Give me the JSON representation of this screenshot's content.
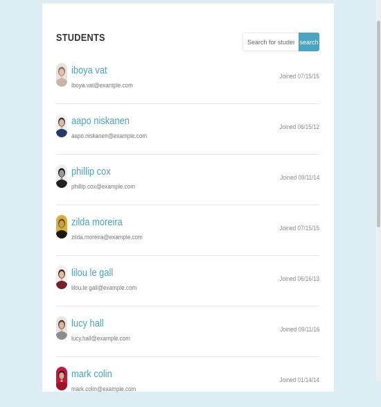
{
  "header": {
    "title": "STUDENTS"
  },
  "search": {
    "placeholder": "Search for students...",
    "button_label": "search"
  },
  "colors": {
    "accent": "#4aa3c0",
    "page_background": "#dcedf3"
  },
  "students": [
    {
      "name": "iboya vat",
      "email": "iboya.vat@example.com",
      "joined": "Joined 07/15/15",
      "avatar": {
        "hair": "#8a6a58",
        "skin": "#e3c2ad",
        "shirt": "#c9b3a8",
        "bg": "#e8e2dd"
      }
    },
    {
      "name": "aapo niskanen",
      "email": "aapo.niskanen@example.com",
      "joined": "Joined 06/15/12",
      "avatar": {
        "hair": "#3a3a3a",
        "skin": "#dcbba3",
        "shirt": "#233a6b",
        "bg": "#f1f1f1"
      }
    },
    {
      "name": "phillip cox",
      "email": "phillip.cox@example.com",
      "joined": "Joined 09/11/14",
      "avatar": {
        "hair": "#111111",
        "skin": "#9a9a9a",
        "shirt": "#222222",
        "bg": "#ededed"
      }
    },
    {
      "name": "zilda moreira",
      "email": "zilda.moreira@example.com",
      "joined": "Joined 07/15/15",
      "avatar": {
        "hair": "#6b4a12",
        "skin": "#c7a24a",
        "shirt": "#1f1a10",
        "bg": "#d6b23a"
      }
    },
    {
      "name": "lilou le gall",
      "email": "lilou.le gall@example.com",
      "joined": "Joined 06/16/13",
      "avatar": {
        "hair": "#3b2a22",
        "skin": "#e0b9a3",
        "shirt": "#7a1f2a",
        "bg": "#f2efec"
      }
    },
    {
      "name": "lucy hall",
      "email": "lucy.hall@example.com",
      "joined": "Joined 09/11/16",
      "avatar": {
        "hair": "#4a3b33",
        "skin": "#d9b59d",
        "shirt": "#8d8d8d",
        "bg": "#e9e4e0"
      }
    },
    {
      "name": "mark colin",
      "email": "mark.colin@example.com",
      "joined": "Joined 01/14/14",
      "avatar": {
        "hair": "#2c1c1c",
        "skin": "#d7a490",
        "shirt": "#a0142a",
        "bg": "#c9163a"
      }
    }
  ]
}
